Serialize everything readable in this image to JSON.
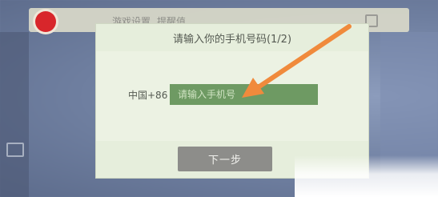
{
  "background": {
    "tabs": [
      "游戏设置",
      "提醒值"
    ]
  },
  "dialog": {
    "title": "请输入你的手机号码(1/2)",
    "country_code": "中国+86",
    "phone_placeholder": "请输入手机号",
    "phone_value": "",
    "next_label": "下一步"
  },
  "annotation": {
    "arrow_color": "#f08a3c"
  },
  "colors": {
    "dialog_bg": "#e6eedc",
    "input_bg": "#6e9a63",
    "button_bg": "#8d8d8a"
  }
}
